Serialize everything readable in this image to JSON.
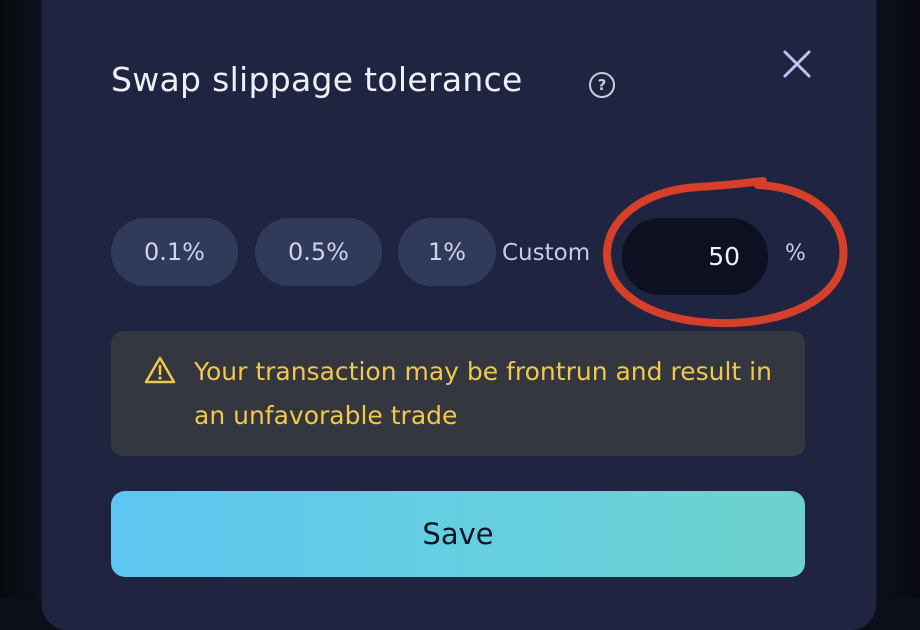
{
  "modal": {
    "title": "Swap slippage tolerance",
    "help_icon": "question-circle-icon",
    "close_icon": "close-icon"
  },
  "slippage": {
    "options": [
      "0.1%",
      "0.5%",
      "1%"
    ],
    "custom_label": "Custom",
    "custom_value": "50",
    "unit": "%"
  },
  "warning": {
    "icon": "warning-triangle-icon",
    "text": "Your transaction may be frontrun and result in an unfavorable trade",
    "color": "#f2c84b"
  },
  "actions": {
    "save_label": "Save"
  },
  "annotation": {
    "highlight_color": "#d6402b"
  }
}
